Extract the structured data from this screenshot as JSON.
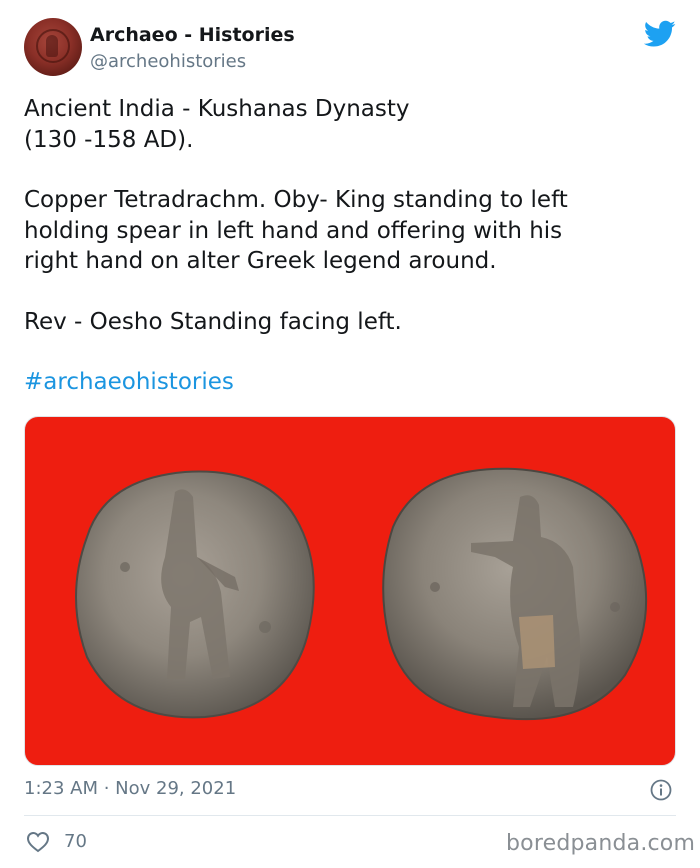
{
  "author": {
    "name": "Archaeo - Histories",
    "handle": "@archeohistories",
    "avatar_icon": "coin-avatar"
  },
  "tweet": {
    "paragraphs": [
      "Ancient India - Kushanas Dynasty\n(130 -158 AD).",
      "Copper Tetradrachm. Oby- King standing to left\nholding spear in left hand and offering with his\nright hand on alter Greek legend around.",
      "Rev - Oesho Standing facing left."
    ],
    "hashtag": "#archaeohistories"
  },
  "media": {
    "description_icon": "coin-photo",
    "background_color": "#ee1e10"
  },
  "meta": {
    "timestamp": "1:23 AM · Nov 29, 2021",
    "like_count": "70"
  },
  "watermark": "boredpanda.com",
  "colors": {
    "twitter_blue": "#1da1f2",
    "hashtag": "#1b95e0",
    "secondary_text": "#657786"
  }
}
